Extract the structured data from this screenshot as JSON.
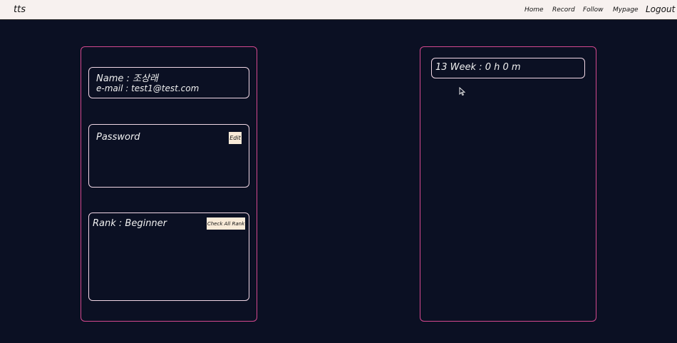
{
  "navbar": {
    "brand": "tts",
    "links": [
      "Home",
      "Record",
      "Follow",
      "Mypage"
    ],
    "logout": "Logout"
  },
  "profile": {
    "name_line": "Name : 조상래",
    "email_line": "e-mail : test1@test.com"
  },
  "password": {
    "label": "Password",
    "edit_button": "Edit"
  },
  "rank": {
    "label": "Rank : Beginner",
    "button": "Check All Rank"
  },
  "weekly": {
    "summary": "13 Week : 0 h 0 m"
  },
  "colors": {
    "background": "#0b1023",
    "navbar": "#f7f1ef",
    "panel_border": "#d4488f",
    "card_border": "#f0d6e4",
    "button_bg": "#f8ead8"
  }
}
